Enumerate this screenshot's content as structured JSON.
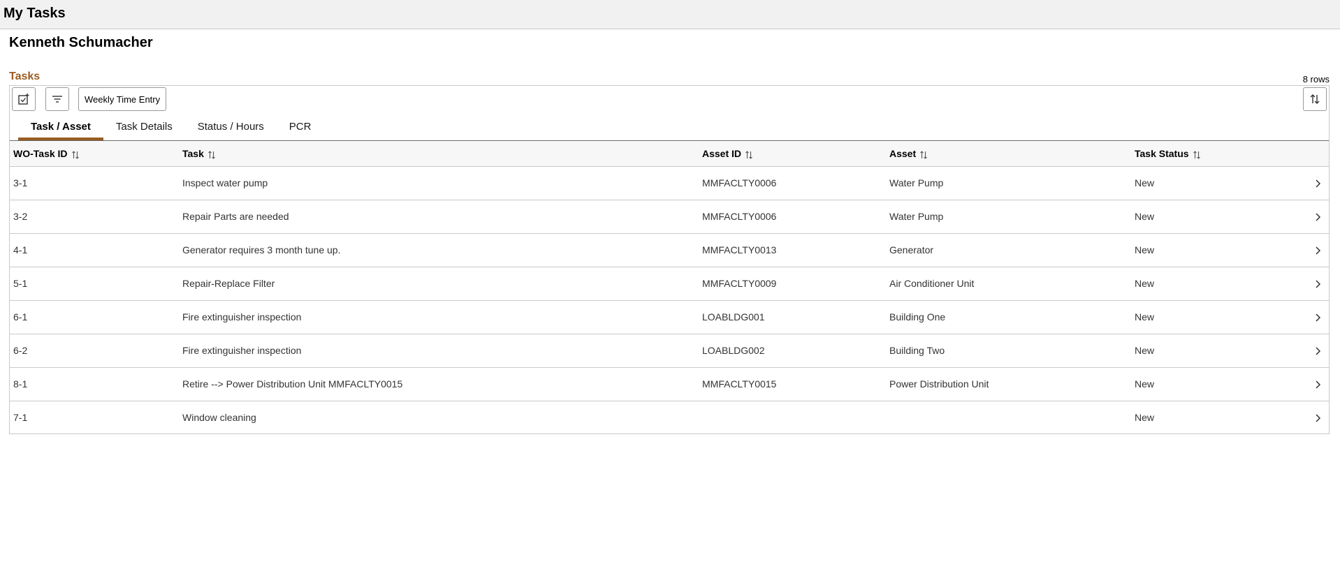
{
  "header": {
    "title": "My Tasks"
  },
  "user": {
    "name": "Kenneth Schumacher"
  },
  "grid": {
    "title": "Tasks",
    "row_count": "8 rows",
    "toolbar": {
      "select_icon": "checkbox-add-icon",
      "filter_icon": "filter-icon",
      "weekly_time_entry_label": "Weekly Time Entry",
      "sort_icon": "sort-icon"
    },
    "tabs": [
      {
        "label": "Task / Asset",
        "active": true
      },
      {
        "label": "Task Details",
        "active": false
      },
      {
        "label": "Status / Hours",
        "active": false
      },
      {
        "label": "PCR",
        "active": false
      }
    ],
    "columns": [
      "WO-Task ID",
      "Task",
      "Asset ID",
      "Asset",
      "Task Status"
    ],
    "rows": [
      {
        "wo_task_id": "3-1",
        "task": "Inspect water pump",
        "asset_id": "MMFACLTY0006",
        "asset": "Water Pump",
        "status": "New"
      },
      {
        "wo_task_id": "3-2",
        "task": "Repair Parts are needed",
        "asset_id": "MMFACLTY0006",
        "asset": "Water Pump",
        "status": "New"
      },
      {
        "wo_task_id": "4-1",
        "task": "Generator requires 3 month tune up.",
        "asset_id": "MMFACLTY0013",
        "asset": "Generator",
        "status": "New"
      },
      {
        "wo_task_id": "5-1",
        "task": "Repair-Replace Filter",
        "asset_id": "MMFACLTY0009",
        "asset": "Air Conditioner Unit",
        "status": "New"
      },
      {
        "wo_task_id": "6-1",
        "task": "Fire extinguisher inspection",
        "asset_id": "LOABLDG001",
        "asset": "Building One",
        "status": "New"
      },
      {
        "wo_task_id": "6-2",
        "task": "Fire extinguisher inspection",
        "asset_id": "LOABLDG002",
        "asset": "Building Two",
        "status": "New"
      },
      {
        "wo_task_id": "8-1",
        "task": "Retire --> Power Distribution Unit MMFACLTY0015",
        "asset_id": "MMFACLTY0015",
        "asset": "Power Distribution Unit",
        "status": "New"
      },
      {
        "wo_task_id": "7-1",
        "task": "Window cleaning",
        "asset_id": "",
        "asset": "",
        "status": "New"
      }
    ]
  },
  "colors": {
    "accent": "#9a5c22",
    "header_bg": "#f1f1f1",
    "border": "#c9c9c9"
  }
}
